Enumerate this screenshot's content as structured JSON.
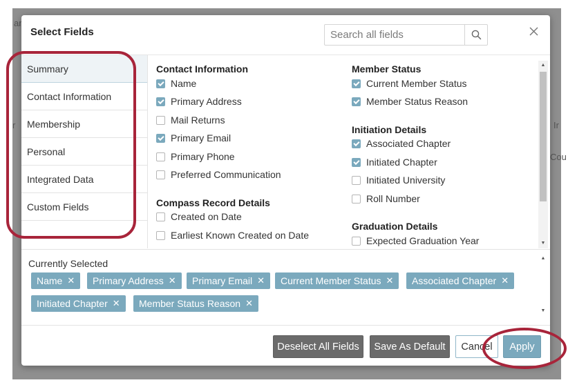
{
  "background": {
    "fragments": [
      "ar",
      "r",
      "Ir",
      "Cou"
    ]
  },
  "dialog": {
    "title": "Select Fields",
    "search_placeholder": "Search all fields",
    "search_icon": "search-icon",
    "close_icon": "close-icon"
  },
  "nav": {
    "items": [
      {
        "label": "Summary",
        "active": true
      },
      {
        "label": "Contact Information"
      },
      {
        "label": "Membership"
      },
      {
        "label": "Personal"
      },
      {
        "label": "Integrated Data"
      },
      {
        "label": "Custom Fields"
      }
    ]
  },
  "fields": {
    "left": {
      "group1": {
        "title": "Contact Information",
        "items": [
          {
            "label": "Name",
            "checked": true
          },
          {
            "label": "Primary Address",
            "checked": true
          },
          {
            "label": "Mail Returns",
            "checked": false
          },
          {
            "label": "Primary Email",
            "checked": true
          },
          {
            "label": "Primary Phone",
            "checked": false
          },
          {
            "label": "Preferred Communication",
            "checked": false
          }
        ]
      },
      "group2": {
        "title": "Compass Record Details",
        "items": [
          {
            "label": "Created on Date",
            "checked": false
          },
          {
            "label": "Earliest Known Created on Date",
            "checked": false
          }
        ]
      }
    },
    "right": {
      "group1": {
        "title": "Member Status",
        "items": [
          {
            "label": "Current Member Status",
            "checked": true
          },
          {
            "label": "Member Status Reason",
            "checked": true
          }
        ]
      },
      "group2": {
        "title": "Initiation Details",
        "items": [
          {
            "label": "Associated Chapter",
            "checked": true
          },
          {
            "label": "Initiated Chapter",
            "checked": true
          },
          {
            "label": "Initiated University",
            "checked": false
          },
          {
            "label": "Roll Number",
            "checked": false
          }
        ]
      },
      "group3": {
        "title": "Graduation Details",
        "items": [
          {
            "label": "Expected Graduation Year",
            "checked": false
          }
        ]
      }
    }
  },
  "selected": {
    "label": "Currently Selected",
    "chips": [
      "Name",
      "Primary Address",
      "Primary Email",
      "Current Member Status",
      "Associated Chapter",
      "Initiated Chapter",
      "Member Status Reason"
    ],
    "remove_glyph": "✕"
  },
  "footer": {
    "deselect_all": "Deselect All Fields",
    "save_default": "Save As Default",
    "cancel": "Cancel",
    "apply": "Apply"
  },
  "colors": {
    "accent": "#7ba9bd",
    "annotation": "#a8243a",
    "dark_button": "#6b6b6b"
  }
}
